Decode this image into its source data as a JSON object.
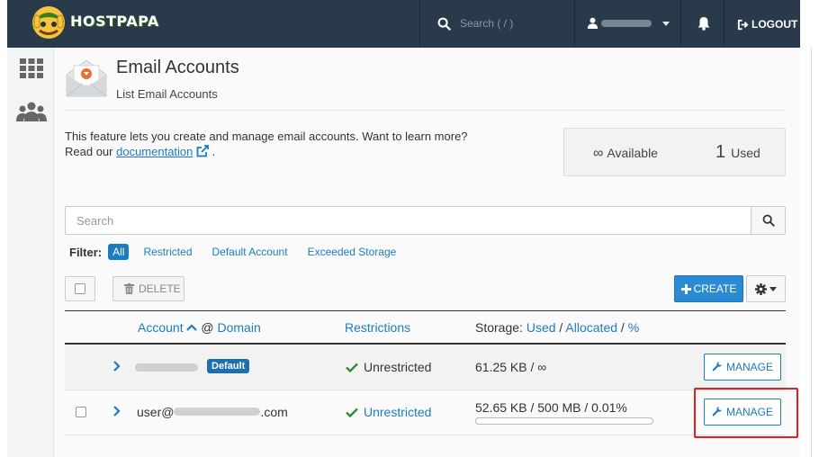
{
  "topbar": {
    "brand": "HOSTPAPA",
    "search_placeholder": "Search ( / )",
    "logout_label": "LOGOUT"
  },
  "page": {
    "title": "Email Accounts",
    "subtitle": "List Email Accounts",
    "intro_line1": "This feature lets you create and manage email accounts. Want to learn more?",
    "intro_prefix": "Read our",
    "intro_link": "documentation",
    "intro_suffix": "."
  },
  "stats": {
    "available_symbol": "∞",
    "available_label": "Available",
    "used_count": "1",
    "used_label": "Used"
  },
  "search": {
    "placeholder": "Search"
  },
  "filter": {
    "label": "Filter:",
    "options": [
      "All",
      "Restricted",
      "Default Account",
      "Exceeded Storage"
    ],
    "selected": "All"
  },
  "toolbar": {
    "delete_label": "DELETE",
    "create_label": "CREATE"
  },
  "table": {
    "col_account": "Account",
    "col_at": "@",
    "col_domain": "Domain",
    "col_restrictions": "Restrictions",
    "col_storage_prefix": "Storage:",
    "col_storage_used": "Used",
    "col_storage_sep": "/",
    "col_storage_allocated": "Allocated",
    "col_storage_pct": "%",
    "rows": [
      {
        "badge": "Default",
        "restriction": "Unrestricted",
        "storage": "61.25 KB / ∞",
        "manage_label": "MANAGE"
      },
      {
        "account_prefix": "user@",
        "account_suffix": ".com",
        "restriction": "Unrestricted",
        "storage": "52.65 KB / 500 MB / 0.01%",
        "storage_fraction": 0.0001,
        "manage_label": "MANAGE"
      }
    ]
  },
  "colors": {
    "topbar": "#293a4a",
    "accent": "#1b7cc0",
    "success": "#2e8b3a",
    "highlight": "#e02020"
  }
}
